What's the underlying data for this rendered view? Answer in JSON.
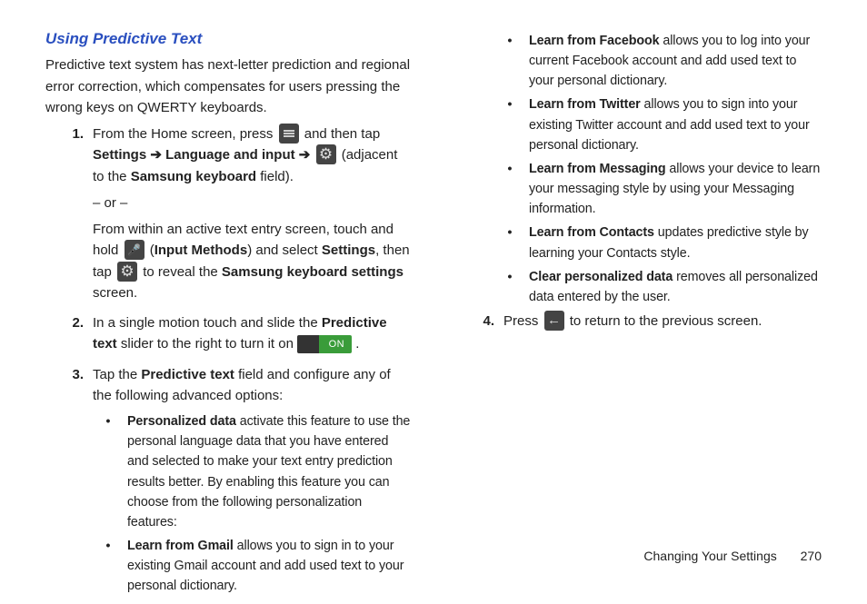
{
  "heading": "Using Predictive Text",
  "intro": "Predictive text system has next-letter prediction and regional error correction, which compensates for users pressing the wrong keys on QWERTY keyboards.",
  "step1": {
    "num": "1.",
    "p1_a": "From the Home screen, press ",
    "p1_b": " and then tap ",
    "p1_c": "Settings",
    "p1_d": "Language and input",
    "p1_e": " (adjacent to the ",
    "p1_f": "Samsung keyboard",
    "p1_g": " field).",
    "or": "– or –",
    "p2": "From within an active text entry screen, touch and hold ",
    "p2_b": " (",
    "p2_c": "Input Methods",
    "p2_d": ") and select ",
    "p2_e": "Settings",
    "p2_f": ", then tap ",
    "p2_g": " to reveal the ",
    "p2_h": "Samsung keyboard settings",
    "p2_i": " screen."
  },
  "step2": {
    "num": "2.",
    "a": "In a single motion touch and slide the ",
    "b": "Predictive text",
    "c": " slider to the right to turn it on ",
    "on": "ON",
    "d": "."
  },
  "step3": {
    "num": "3.",
    "a": "Tap the ",
    "b": "Predictive text",
    "c": " field and configure any of the following advanced options:"
  },
  "bullets_left": [
    {
      "title": "Personalized data",
      "body": " activate this feature to use the personal language data that you have entered and selected to make your text entry prediction results better. By enabling this feature you can choose from the following personalization features:"
    },
    {
      "title": "Learn from Gmail",
      "body": " allows you to sign in to your existing Gmail account and add used text to your personal dictionary."
    }
  ],
  "bullets_right": [
    {
      "title": "Learn from Facebook",
      "body": " allows you to log into your current Facebook account and add used text to your personal dictionary."
    },
    {
      "title": "Learn from Twitter",
      "body": " allows you to sign into your existing Twitter account and add used text to your personal dictionary."
    },
    {
      "title": "Learn from Messaging",
      "body": " allows your device to learn your messaging style by using your Messaging information."
    },
    {
      "title": "Learn from Contacts",
      "body": " updates predictive style by learning your Contacts style."
    },
    {
      "title": "Clear personalized data",
      "body": " removes all personalized data entered by the user."
    }
  ],
  "step4": {
    "num": "4.",
    "a": "Press ",
    "b": " to return to the previous screen."
  },
  "footer": {
    "section": "Changing Your Settings",
    "page": "270"
  },
  "arrow": "➔"
}
